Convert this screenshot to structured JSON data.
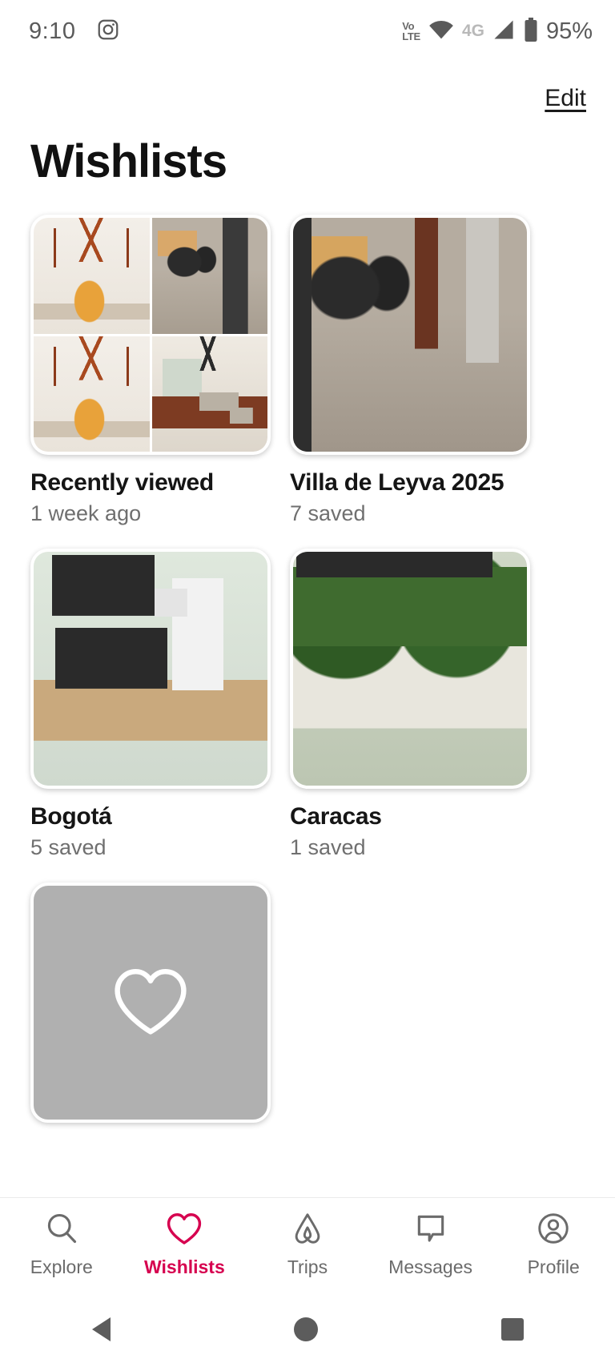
{
  "status_bar": {
    "time": "9:10",
    "app_icon": "instagram-icon",
    "volte_top": "Vo",
    "volte_bottom": "LTE",
    "network": "4G",
    "battery": "95%"
  },
  "header": {
    "edit_label": "Edit",
    "title": "Wishlists"
  },
  "wishlists": [
    {
      "title": "Recently viewed",
      "subtitle": "1 week ago",
      "thumb_type": "collage"
    },
    {
      "title": "Villa de Leyva 2025",
      "subtitle": "7 saved",
      "thumb_type": "single"
    },
    {
      "title": "Bogotá",
      "subtitle": "5 saved",
      "thumb_type": "single"
    },
    {
      "title": "Caracas",
      "subtitle": "1 saved",
      "thumb_type": "single"
    }
  ],
  "placeholder_card": {
    "icon": "heart-outline-icon",
    "title": "",
    "subtitle": ""
  },
  "bottom_nav": {
    "active_color": "#d6004f",
    "inactive_color": "#6b6b6b",
    "items": [
      {
        "label": "Explore",
        "icon": "search-icon",
        "active": false
      },
      {
        "label": "Wishlists",
        "icon": "heart-icon",
        "active": true
      },
      {
        "label": "Trips",
        "icon": "airbnb-belo-icon",
        "active": false
      },
      {
        "label": "Messages",
        "icon": "message-bubble-icon",
        "active": false
      },
      {
        "label": "Profile",
        "icon": "user-circle-icon",
        "active": false
      }
    ]
  },
  "system_nav": {
    "back": "back-triangle-icon",
    "home": "home-circle-icon",
    "recents": "recents-square-icon"
  }
}
